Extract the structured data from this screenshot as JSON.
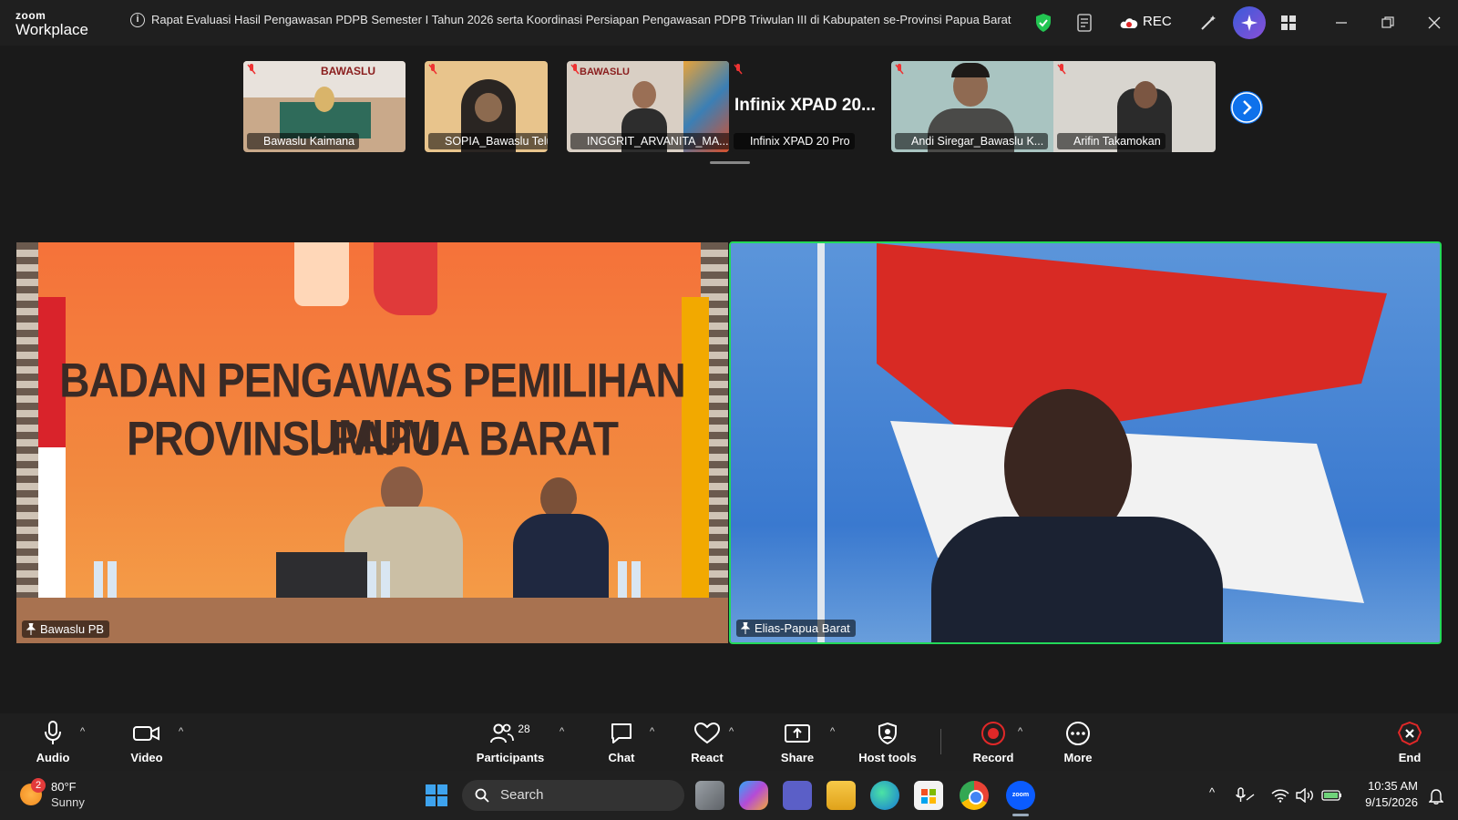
{
  "app": {
    "logo_line1": "zoom",
    "logo_line2": "Workplace",
    "meeting_title": "Rapat Evaluasi Hasil Pengawasan PDPB Semester I Tahun 2026 serta Koordinasi Persiapan Pengawasan PDPB Triwulan III di Kabupaten se-Provinsi Papua Barat",
    "rec_label": "REC"
  },
  "thumbnails": [
    {
      "name": "Bawaslu Kaimana",
      "bg": "#c9a98a"
    },
    {
      "name": "SOPIA_Bawaslu Teluk Bi...",
      "bg": "#e8c48c"
    },
    {
      "name": "INGGRIT_ARVANITA_MA...",
      "bg": "#d9cfc4",
      "overlay": "BAWASLU"
    },
    {
      "name": "Infinix XPAD 20 Pro",
      "bg": "#1a1a1a",
      "big_text": "Infinix XPAD 20..."
    },
    {
      "name": "Andi Siregar_Bawaslu K...",
      "bg": "#a9c4c1"
    },
    {
      "name": "Arifin Takamokan",
      "bg": "#d8d5cf"
    }
  ],
  "main_videos": {
    "left": {
      "name": "Bawaslu PB",
      "banner_line1": "BADAN PENGAWAS PEMILIHAN UMUM",
      "banner_line2": "PROVINSI PAPUA BARAT"
    },
    "right": {
      "name": "Elias-Papua Barat"
    }
  },
  "controls": {
    "audio": "Audio",
    "video": "Video",
    "participants": "Participants",
    "participants_count": "28",
    "chat": "Chat",
    "react": "React",
    "share": "Share",
    "host_tools": "Host tools",
    "record": "Record",
    "more": "More",
    "end": "End"
  },
  "taskbar": {
    "weather_temp": "80°F",
    "weather_desc": "Sunny",
    "weather_badge": "2",
    "search_label": "Search",
    "time": "10:35 AM",
    "date": "9/15/2026"
  },
  "colors": {
    "accent_blue": "#0e71eb",
    "active_speaker": "#23d959",
    "record_red": "#e02828"
  }
}
